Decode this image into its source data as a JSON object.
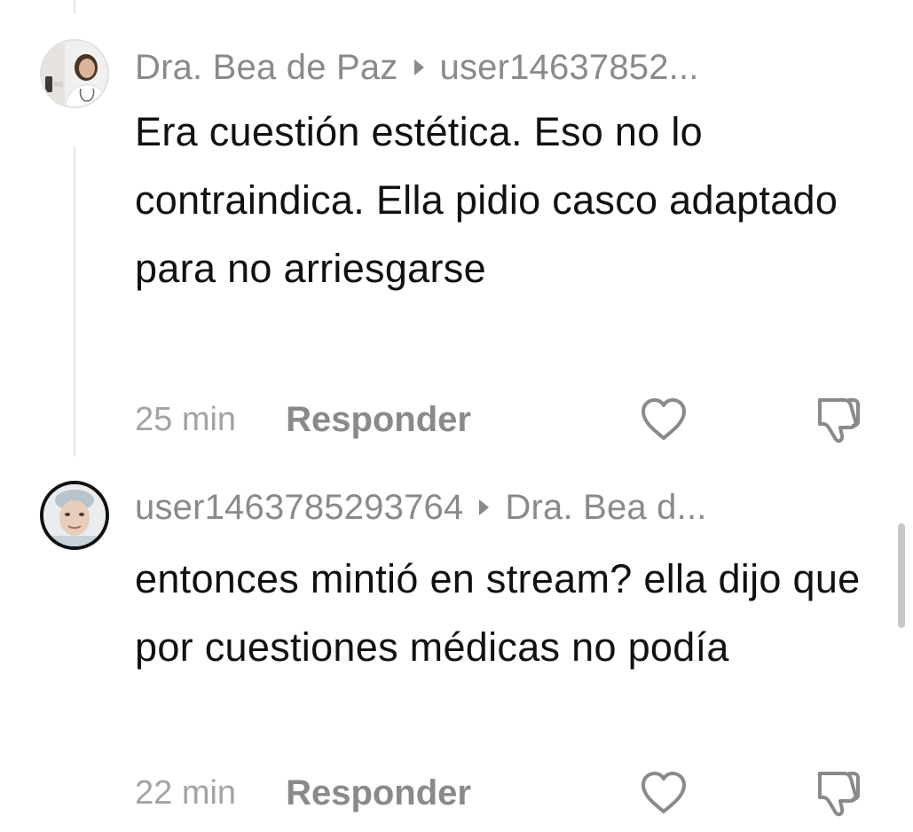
{
  "comments": [
    {
      "author": "Dra. Bea de Paz",
      "reply_to": "user14637852...",
      "text": "Era cuestión estética. Eso no lo contraindica. Ella pidio casco adaptado para no arriesgarse",
      "time": "25 min",
      "reply_label": "Responder",
      "avatar": "doctor-avatar-icon"
    },
    {
      "author": "user1463785293764",
      "reply_to": "Dra. Bea d...",
      "text": "entonces mintió en stream? ella dijo que por cuestiones médicas no podía",
      "time": "22 min",
      "reply_label": "Responder",
      "avatar": "user-avatar-icon"
    }
  ],
  "colors": {
    "author_gray": "#8a8a8a",
    "text_black": "#111111",
    "time_gray": "#a3a3a3",
    "thread_line": "#e6e6e6"
  }
}
